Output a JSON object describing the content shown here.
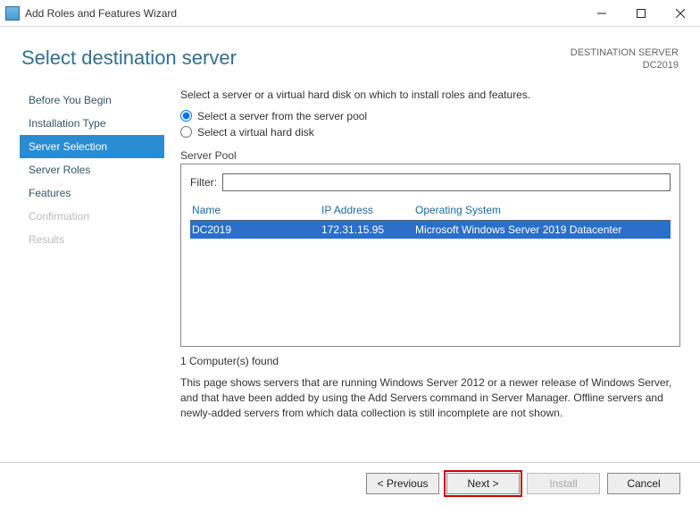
{
  "titlebar": {
    "title": "Add Roles and Features Wizard"
  },
  "header": {
    "title": "Select destination server",
    "dest_label": "DESTINATION SERVER",
    "dest_value": "DC2019"
  },
  "sidebar": {
    "items": [
      {
        "label": "Before You Begin",
        "state": "normal"
      },
      {
        "label": "Installation Type",
        "state": "normal"
      },
      {
        "label": "Server Selection",
        "state": "selected"
      },
      {
        "label": "Server Roles",
        "state": "normal"
      },
      {
        "label": "Features",
        "state": "normal"
      },
      {
        "label": "Confirmation",
        "state": "disabled"
      },
      {
        "label": "Results",
        "state": "disabled"
      }
    ]
  },
  "main": {
    "intro": "Select a server or a virtual hard disk on which to install roles and features.",
    "radio1": "Select a server from the server pool",
    "radio2": "Select a virtual hard disk",
    "server_pool_label": "Server Pool",
    "filter_label": "Filter:",
    "filter_value": "",
    "columns": {
      "name": "Name",
      "ip": "IP Address",
      "os": "Operating System"
    },
    "rows": [
      {
        "name": "DC2019",
        "ip": "172.31.15.95",
        "os": "Microsoft Windows Server 2019 Datacenter",
        "selected": true
      }
    ],
    "found_text": "1 Computer(s) found",
    "note": "This page shows servers that are running Windows Server 2012 or a newer release of Windows Server, and that have been added by using the Add Servers command in Server Manager. Offline servers and newly-added servers from which data collection is still incomplete are not shown."
  },
  "footer": {
    "previous": "< Previous",
    "next": "Next >",
    "install": "Install",
    "cancel": "Cancel"
  }
}
